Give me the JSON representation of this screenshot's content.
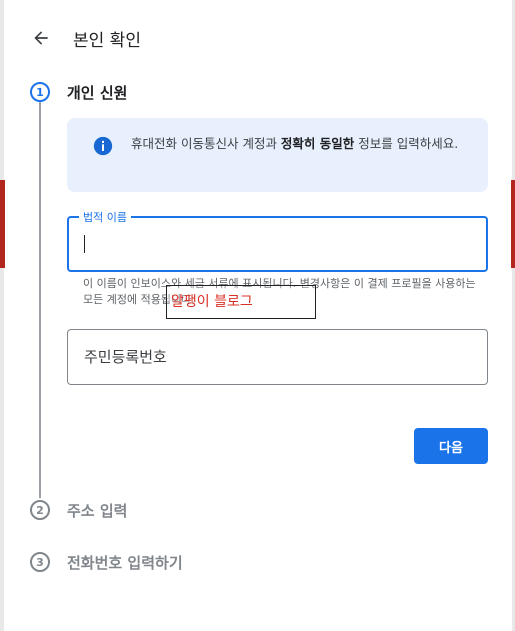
{
  "dialog": {
    "title": "본인 확인"
  },
  "steps": [
    {
      "number": "1",
      "label": "개인 신원",
      "state": "active"
    },
    {
      "number": "2",
      "label": "주소 입력",
      "state": "inactive"
    },
    {
      "number": "3",
      "label": "전화번호 입력하기",
      "state": "inactive"
    }
  ],
  "info": {
    "text_pre": "휴대전화 이동통신사 계정과 ",
    "text_bold": "정확히 동일한",
    "text_post": " 정보를 입력하세요."
  },
  "legal_name": {
    "label": "법적 이름",
    "value": ""
  },
  "helper": {
    "text": "이 이름이 인보이스와 세금 서류에 표시됩니다. 변경사항은 이 결제 프로필을 사용하는 모든 계정에 적용됩니다."
  },
  "overlay": {
    "text": "알팽이 블로그"
  },
  "rrn": {
    "placeholder": "주민등록번호",
    "value": ""
  },
  "next_button": {
    "label": "다음"
  },
  "colors": {
    "accent": "#1a73e8",
    "info_bg": "#e8f0fe",
    "overlay_text": "#d93025"
  }
}
